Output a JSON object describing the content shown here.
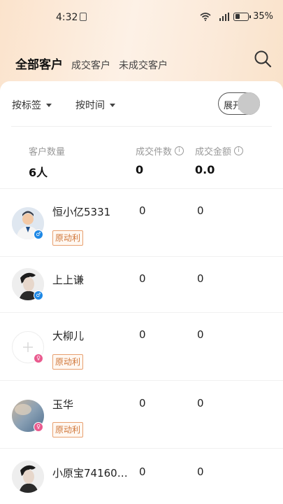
{
  "status": {
    "time": "4:32",
    "battery": "35%"
  },
  "tabs": [
    {
      "label": "全部客户"
    },
    {
      "label": "成交客户"
    },
    {
      "label": "未成交客户"
    }
  ],
  "filters": {
    "tag_label": "按标签",
    "time_label": "按时间",
    "toggle_label": "展开"
  },
  "summary": {
    "count_label": "客户数量",
    "count_value": "6人",
    "deals_label": "成交件数",
    "deals_value": "0",
    "amount_label": "成交金额",
    "amount_value": "0.0"
  },
  "customers": [
    {
      "name": "恒小亿5331",
      "deals": "0",
      "amount": "0",
      "tag": "原动利",
      "gender": "male"
    },
    {
      "name": "上上谦",
      "deals": "0",
      "amount": "0",
      "tag": "",
      "gender": "male"
    },
    {
      "name": "大柳儿",
      "deals": "0",
      "amount": "0",
      "tag": "原动利",
      "gender": "female"
    },
    {
      "name": "玉华",
      "deals": "0",
      "amount": "0",
      "tag": "原动利",
      "gender": "female"
    },
    {
      "name": "小原宝74160…",
      "deals": "0",
      "amount": "0",
      "tag": "",
      "gender": ""
    }
  ],
  "icons": {
    "search": "search-icon",
    "info": "info-icon",
    "male": "male-icon",
    "female": "female-icon",
    "caret": "caret-down-icon"
  },
  "colors": {
    "tag_border": "#e8a070",
    "tag_text": "#d0773a",
    "male": "#1e88e5",
    "female": "#e95a8e"
  }
}
